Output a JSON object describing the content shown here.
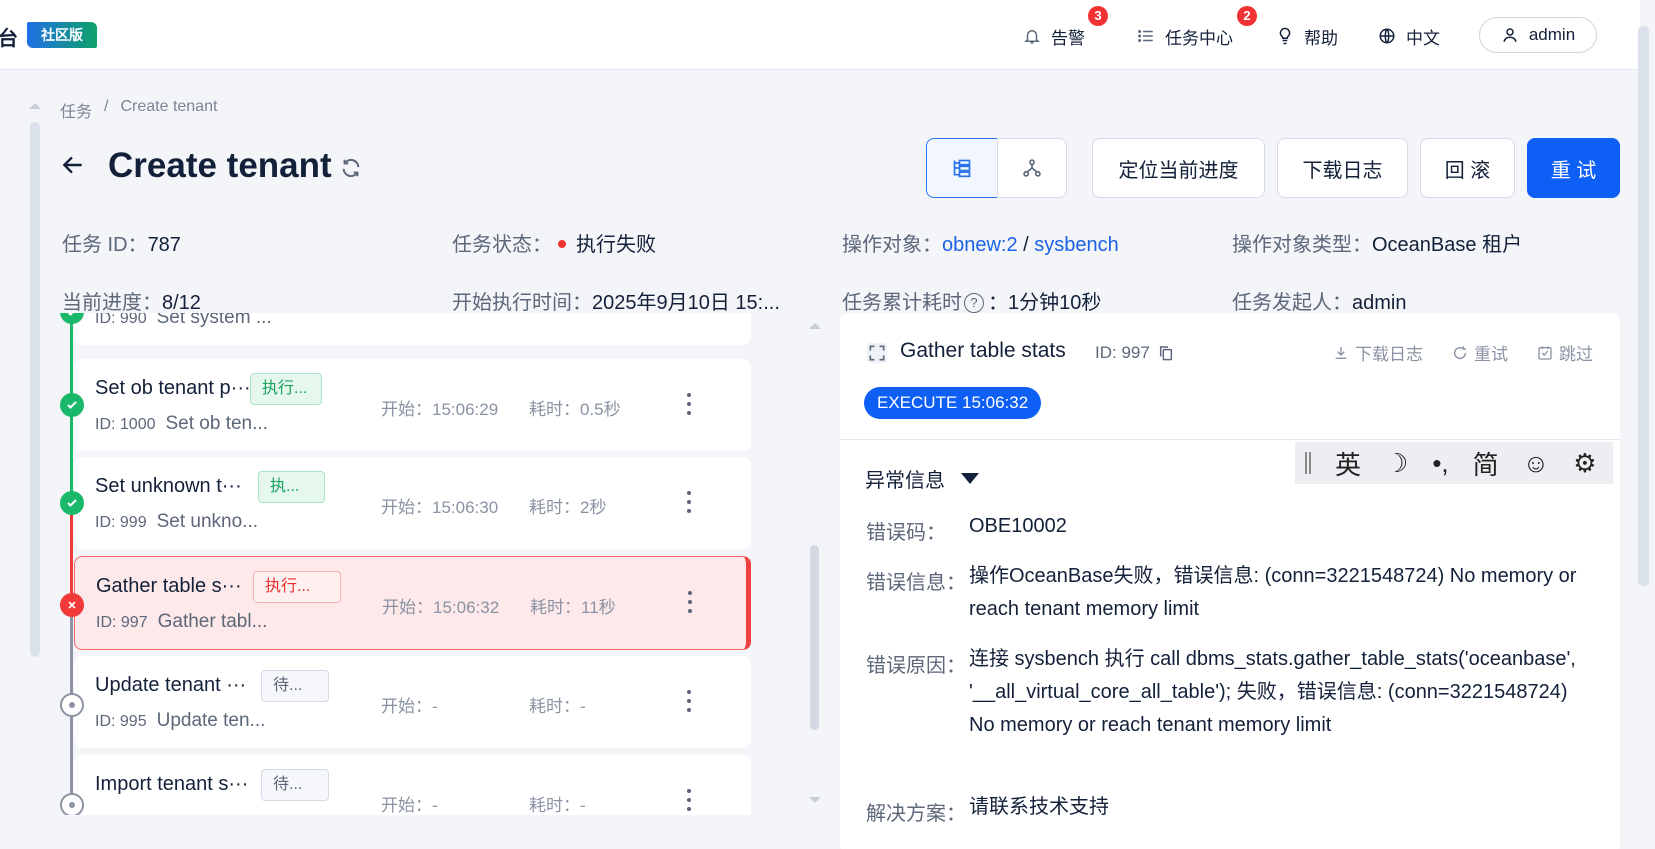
{
  "header": {
    "brand_tail": "台",
    "edition": "社区版",
    "nav": [
      {
        "label": "告警",
        "icon": "bell-icon",
        "badge": "3"
      },
      {
        "label": "任务中心",
        "icon": "list-icon",
        "badge": "2"
      },
      {
        "label": "帮助",
        "icon": "bulb-icon"
      },
      {
        "label": "中文",
        "icon": "globe-icon"
      }
    ],
    "user": "admin"
  },
  "breadcrumb": {
    "parent": "任务",
    "sep": "/",
    "current": "Create tenant"
  },
  "page": {
    "title": "Create tenant"
  },
  "toolbar": {
    "locate": "定位当前进度",
    "download": "下载日志",
    "rollback": "回 滚",
    "retry": "重 试"
  },
  "info": {
    "task_id_label": "任务 ID：",
    "task_id": "787",
    "status_label": "任务状态：",
    "status": "执行失败",
    "status_color": "#f23232",
    "target_label": "操作对象：",
    "target_a": "obnew:2",
    "target_sep": " / ",
    "target_b": "sysbench",
    "target_type_label": "操作对象类型：",
    "target_type": "OceanBase 租户",
    "progress_label": "当前进度：",
    "progress": "8/12",
    "start_label": "开始执行时间：",
    "start": "2025年9月10日 15:...",
    "elapsed_label": "任务累计耗时",
    "elapsed_help": "?",
    "elapsed": "：1分钟10秒",
    "initiator_label": "任务发起人：",
    "initiator": "admin"
  },
  "tasks": [
    {
      "name": "",
      "tag": "",
      "tag_color": "",
      "id": "ID: 990",
      "desc": "Set system ...",
      "start": "",
      "cost": "",
      "status": "ok"
    },
    {
      "name": "Set ob tenant p···",
      "tag": "执行...",
      "tag_color": "green",
      "id": "ID: 1000",
      "desc": "Set ob ten...",
      "start": "开始：15:06:29",
      "cost": "耗时：0.5秒",
      "status": "ok"
    },
    {
      "name": "Set unknown t···",
      "tag": "执...",
      "tag_color": "green",
      "id": "ID: 999",
      "desc": "Set unkno...",
      "start": "开始：15:06:30",
      "cost": "耗时：2秒",
      "status": "ok"
    },
    {
      "name": "Gather table s···",
      "tag": "执行...",
      "tag_color": "red",
      "id": "ID: 997",
      "desc": "Gather tabl...",
      "start": "开始：15:06:32",
      "cost": "耗时：11秒",
      "status": "fail"
    },
    {
      "name": "Update tenant ···",
      "tag": "待...",
      "tag_color": "gray",
      "id": "ID: 995",
      "desc": "Update ten...",
      "start": "开始：-",
      "cost": "耗时：-",
      "status": "wait"
    },
    {
      "name": "Import tenant s···",
      "tag": "待...",
      "tag_color": "gray",
      "id": "",
      "desc": "",
      "start": "开始：-",
      "cost": "耗时：-",
      "status": "wait"
    }
  ],
  "detail": {
    "title": "Gather table stats",
    "id": "ID: 997",
    "actions": [
      "下载日志",
      "重试",
      "跳过"
    ],
    "exec": "EXECUTE 15:06:32",
    "section": "异常信息",
    "error_code_label": "错误码：",
    "error_code": "OBE10002",
    "error_msg_label": "错误信息：",
    "error_msg": "操作OceanBase失败，错误信息: (conn=3221548724) No memory or reach tenant memory limit",
    "cause_label": "错误原因：",
    "cause": "连接 sysbench 执行 call dbms_stats.gather_table_stats('oceanbase', '__all_virtual_core_all_table'); 失败，错误信息: (conn=3221548724) No memory or reach tenant memory limit",
    "solution_label": "解决方案：",
    "solution": "请联系技术支持"
  },
  "ime": {
    "items": [
      "英",
      "☽",
      "•,",
      "简",
      "☺",
      "⚙"
    ]
  }
}
